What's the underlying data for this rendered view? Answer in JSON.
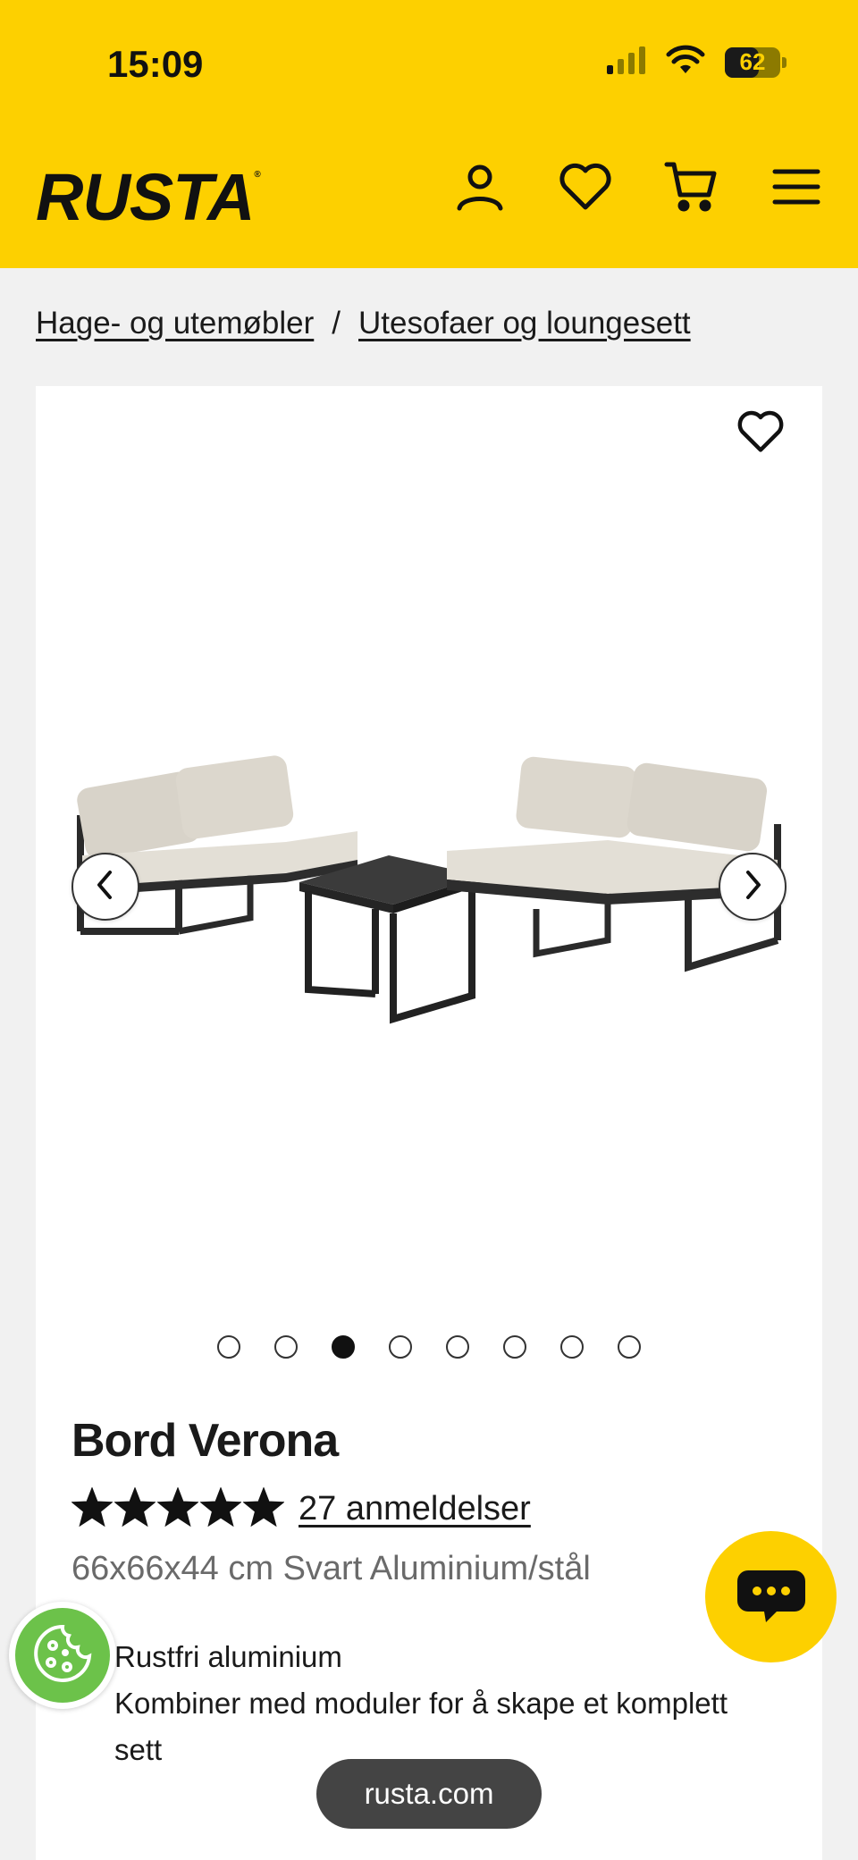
{
  "status_bar": {
    "time": "15:09",
    "battery_level": "62",
    "battery_fraction": 0.62
  },
  "header": {
    "logo": "RUSTA",
    "logo_mark": "®",
    "colors": {
      "brand": "#fdd000"
    }
  },
  "breadcrumb": {
    "items": [
      "Hage- og utemøbler",
      "Utesofaer og loungesett"
    ],
    "separator": "/"
  },
  "gallery": {
    "image_count": 8,
    "active_index": 2,
    "prev_icon": "chevron-left-icon",
    "next_icon": "chevron-right-icon"
  },
  "product": {
    "title": "Bord Verona",
    "rating": 5,
    "reviews_label": "27 anmeldelser",
    "subtitle": "66x66x44 cm Svart Aluminium/stål",
    "features": [
      "Rustfri aluminium",
      "Kombiner med moduler for å skape et komplett sett"
    ]
  },
  "browser": {
    "url": "rusta.com"
  },
  "icons": [
    "user-icon",
    "heart-icon",
    "cart-icon",
    "menu-icon",
    "chat-icon",
    "cookie-icon"
  ]
}
